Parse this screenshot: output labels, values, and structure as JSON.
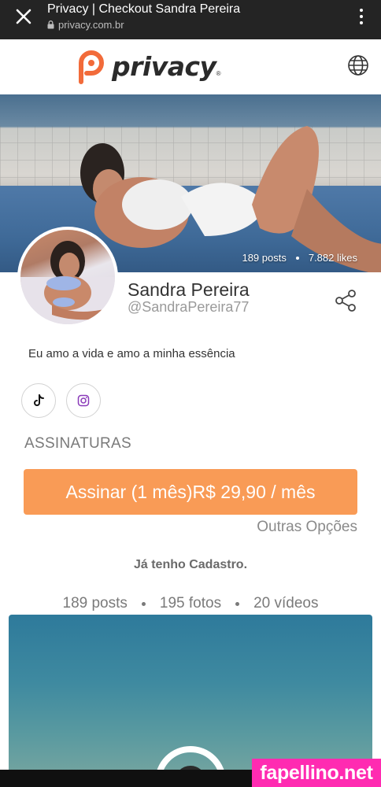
{
  "browser": {
    "title": "Privacy | Checkout Sandra Pereira",
    "url": "privacy.com.br",
    "close_icon": "close-icon",
    "menu_icon": "more-vert-icon"
  },
  "header": {
    "logo_text": "privacy",
    "logo_reg": "®",
    "globe_icon": "globe-icon",
    "brand_color": "#f26b3a"
  },
  "cover": {
    "posts": "189 posts",
    "likes": "7.882 likes"
  },
  "profile": {
    "name": "Sandra Pereira",
    "handle": "@SandraPereira77",
    "bio": "Eu amo a vida e amo a minha essência",
    "share_icon": "share-icon"
  },
  "social": {
    "tiktok_icon": "tiktok-icon",
    "instagram_icon": "instagram-icon",
    "instagram_color": "#8a3ab9"
  },
  "subscriptions": {
    "section_title": "ASSINATURAS",
    "subscribe_label": "Assinar (1 mês)R$ 29,90 / mês",
    "button_color": "#f99b56",
    "other_options": "Outras Opções"
  },
  "login": {
    "label": "Já tenho Cadastro."
  },
  "counts": {
    "posts": "189 posts",
    "photos": "195 fotos",
    "videos": "20 vídeos"
  },
  "watermark": {
    "text": "fapellino.net"
  }
}
